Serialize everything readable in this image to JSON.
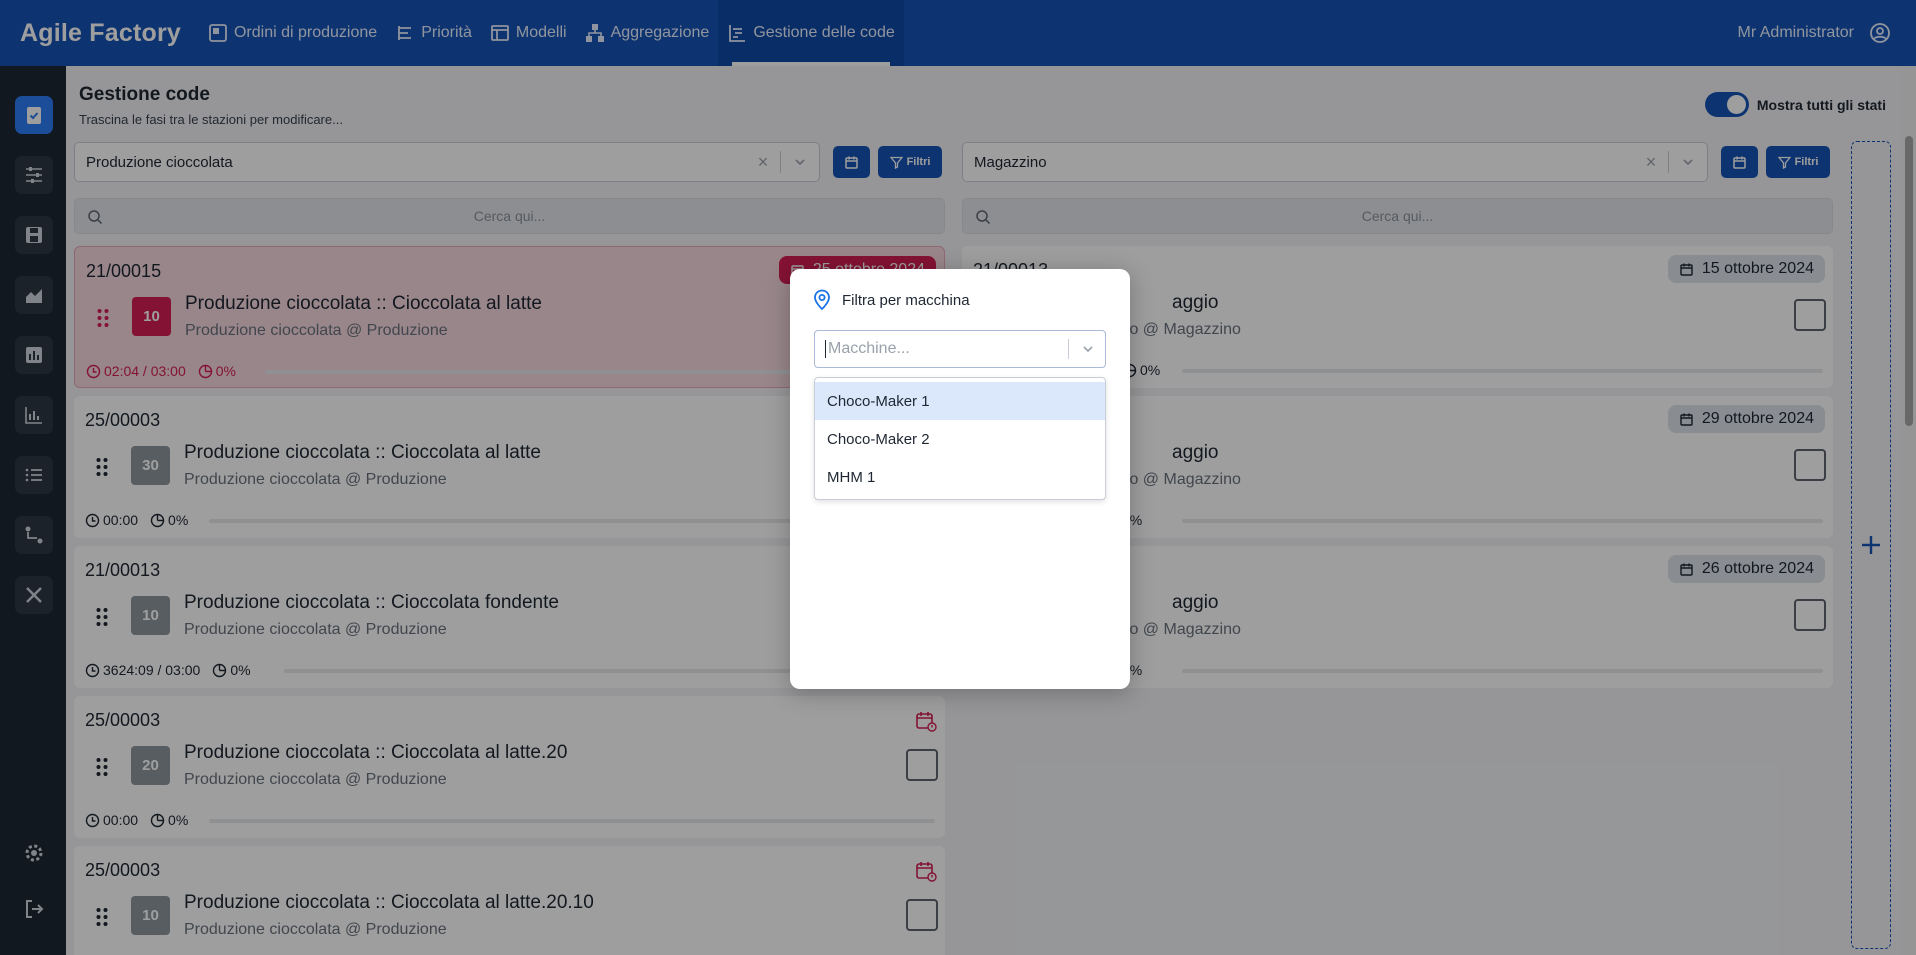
{
  "app": {
    "brand": "Agile Factory",
    "user": "Mr Administrator"
  },
  "nav": [
    {
      "label": "Ordini di produzione",
      "icon": "orders-icon"
    },
    {
      "label": "Priorità",
      "icon": "priority-icon"
    },
    {
      "label": "Modelli",
      "icon": "models-icon"
    },
    {
      "label": "Aggregazione",
      "icon": "aggregation-icon"
    },
    {
      "label": "Gestione delle code",
      "icon": "queue-icon",
      "active": true
    }
  ],
  "page": {
    "title": "Gestione code",
    "subtitle": "Trascina le fasi tra le stazioni per modificare...",
    "toggle_label": "Mostra tutti gli stati"
  },
  "filter_label": "Filtri",
  "search_placeholder": "Cerca qui...",
  "left_column": {
    "station": "Produzione cioccolata",
    "cards": [
      {
        "code": "21/00015",
        "qty": "10",
        "title": "Produzione cioccolata :: Cioccolata al latte",
        "subtitle": "Produzione cioccolata @ Produzione",
        "time": "02:04 / 03:00",
        "progress": "0%",
        "date": "25 ottobre 2024",
        "state": "late"
      },
      {
        "code": "25/00003",
        "qty": "30",
        "title": "Produzione cioccolata :: Cioccolata al latte",
        "subtitle": "Produzione cioccolata @ Produzione",
        "time": "00:00",
        "progress": "0%"
      },
      {
        "code": "21/00013",
        "qty": "10",
        "title": "Produzione cioccolata :: Cioccolata fondente",
        "subtitle": "Produzione cioccolata @ Produzione",
        "time": "3624:09 / 03:00",
        "progress": "0%"
      },
      {
        "code": "25/00003",
        "qty": "20",
        "title": "Produzione cioccolata :: Cioccolata al latte.20",
        "subtitle": "Produzione cioccolata @ Produzione",
        "time": "00:00",
        "progress": "0%"
      },
      {
        "code": "25/00003",
        "qty": "10",
        "title": "Produzione cioccolata :: Cioccolata al latte.20.10",
        "subtitle": "Produzione cioccolata @ Produzione",
        "time": "",
        "progress": ""
      }
    ]
  },
  "right_column": {
    "station": "Magazzino",
    "cards": [
      {
        "code": "21/00013",
        "title_fragment": "aggio",
        "subtitle_fragment": "ino @ Magazzino",
        "progress": "0%",
        "date": "15 ottobre 2024"
      },
      {
        "code": "",
        "title_fragment": "aggio",
        "subtitle_fragment": "ino @ Magazzino",
        "progress": "0%",
        "date": "29 ottobre 2024"
      },
      {
        "code": "",
        "title_fragment": "aggio",
        "subtitle_fragment": "ino @ Magazzino",
        "progress": "0%",
        "date": "26 ottobre 2024"
      }
    ]
  },
  "modal": {
    "title": "Filtra per macchina",
    "placeholder": "Macchine...",
    "options": [
      "Choco-Maker 1",
      "Choco-Maker 2",
      "MHM 1"
    ],
    "highlighted_option": "Choco-Maker 1"
  },
  "colors": {
    "primary": "#1655b6",
    "sidebar": "#1e2833",
    "alert": "#d51d54"
  }
}
